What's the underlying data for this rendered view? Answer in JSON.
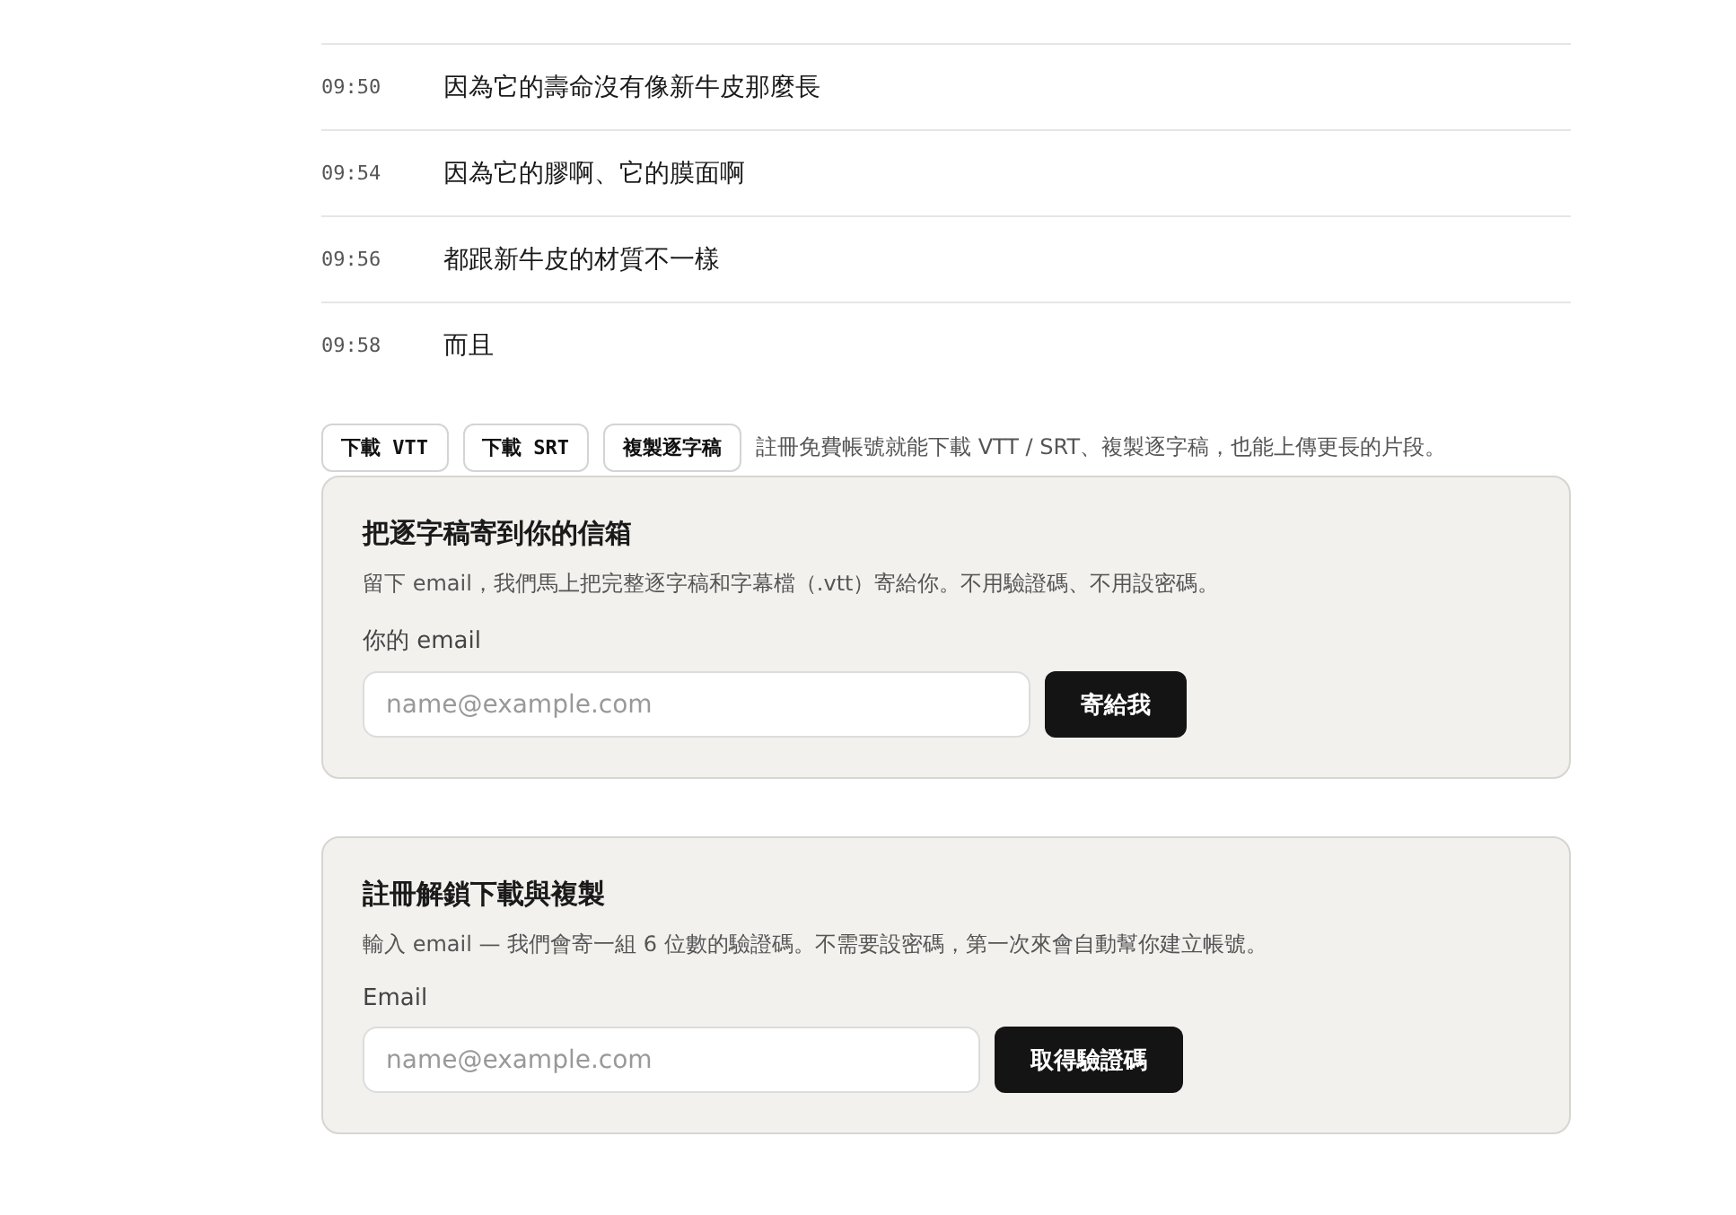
{
  "transcript": [
    {
      "time": "09:50",
      "text": "因為它的壽命沒有像新牛皮那麼長"
    },
    {
      "time": "09:54",
      "text": "因為它的膠啊、它的膜面啊"
    },
    {
      "time": "09:56",
      "text": "都跟新牛皮的材質不一樣"
    },
    {
      "time": "09:58",
      "text": "而且"
    }
  ],
  "actions": {
    "buttons": [
      "下載 VTT",
      "下載 SRT",
      "複製逐字稿"
    ],
    "note": "註冊免費帳號就能下載 VTT / SRT、複製逐字稿，也能上傳更長的片段。"
  },
  "cards": [
    {
      "title": "把逐字稿寄到你的信箱",
      "description": "留下 email，我們馬上把完整逐字稿和字幕檔（.vtt）寄給你。不用驗證碼、不用設密碼。",
      "label": "你的 email",
      "placeholder": "name@example.com",
      "button": "寄給我"
    },
    {
      "title": "註冊解鎖下載與複製",
      "description": "輸入 email — 我們會寄一組 6 位數的驗證碼。不需要設密碼，第一次來會自動幫你建立帳號。",
      "label": "Email",
      "placeholder": "name@example.com",
      "button": "取得驗證碼"
    }
  ]
}
